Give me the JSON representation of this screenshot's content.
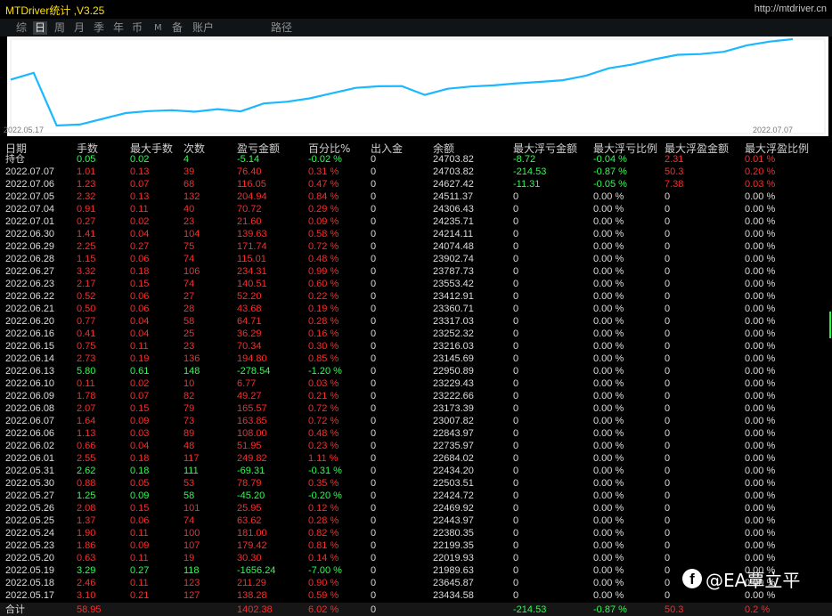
{
  "app_title": "MTDriver统计 ,V3.25",
  "site_link": "http://mtdriver.cn",
  "menu": [
    "综",
    "日",
    "周",
    "月",
    "季",
    "年",
    "币",
    "M",
    "备",
    "账户",
    "路径"
  ],
  "menu_active": "日",
  "chart": {
    "start_label": "2022.05.17",
    "end_label": "2022.07.07",
    "line_color": "#1ab8ff"
  },
  "chart_data": {
    "type": "line",
    "x_start": "2022.05.17",
    "x_end": "2022.07.07",
    "values": [
      23434.58,
      23645.87,
      21989.63,
      22019.93,
      22199.35,
      22380.35,
      22443.97,
      22469.92,
      22424.72,
      22503.51,
      22434.2,
      22684.02,
      22735.97,
      22843.97,
      23007.82,
      23173.39,
      23222.66,
      23229.43,
      22950.89,
      23145.69,
      23216.03,
      23252.32,
      23317.03,
      23360.71,
      23412.91,
      23553.42,
      23787.73,
      23902.74,
      24074.48,
      24214.11,
      24235.71,
      24306.43,
      24511.37,
      24627.42,
      24703.82
    ]
  },
  "headers": [
    "日期",
    "手数",
    "最大手数",
    "次数",
    "盈亏金额",
    "百分比%",
    "出入金",
    "余额",
    "最大浮亏金额",
    "最大浮亏比例",
    "最大浮盈金额",
    "最大浮盈比例"
  ],
  "position_row": {
    "label": "持仓",
    "lots": "0.05",
    "max_lots": "0.02",
    "count": "4",
    "pnl": "-5.14",
    "pct": "-0.02 %",
    "cash": "0",
    "balance": "24703.82",
    "max_loss": "-8.72",
    "max_loss_pct": "-0.04 %",
    "max_gain": "2.31",
    "max_gain_pct": "0.01 %"
  },
  "rows": [
    {
      "date": "2022.07.07",
      "lots": "1.01",
      "max_lots": "0.13",
      "count": "39",
      "pnl": "76.40",
      "pct": "0.31 %",
      "cash": "0",
      "balance": "24703.82",
      "max_loss": "-214.53",
      "max_loss_pct": "-0.87 %",
      "max_gain": "50.3",
      "max_gain_pct": "0.20 %"
    },
    {
      "date": "2022.07.06",
      "lots": "1.23",
      "max_lots": "0.07",
      "count": "68",
      "pnl": "116.05",
      "pct": "0.47 %",
      "cash": "0",
      "balance": "24627.42",
      "max_loss": "-11.31",
      "max_loss_pct": "-0.05 %",
      "max_gain": "7.38",
      "max_gain_pct": "0.03 %"
    },
    {
      "date": "2022.07.05",
      "lots": "2.32",
      "max_lots": "0.13",
      "count": "132",
      "pnl": "204.94",
      "pct": "0.84 %",
      "cash": "0",
      "balance": "24511.37",
      "max_loss": "0",
      "max_loss_pct": "0.00 %",
      "max_gain": "0",
      "max_gain_pct": "0.00 %"
    },
    {
      "date": "2022.07.04",
      "lots": "0.91",
      "max_lots": "0.11",
      "count": "40",
      "pnl": "70.72",
      "pct": "0.29 %",
      "cash": "0",
      "balance": "24306.43",
      "max_loss": "0",
      "max_loss_pct": "0.00 %",
      "max_gain": "0",
      "max_gain_pct": "0.00 %"
    },
    {
      "date": "2022.07.01",
      "lots": "0.27",
      "max_lots": "0.02",
      "count": "23",
      "pnl": "21.60",
      "pct": "0.09 %",
      "cash": "0",
      "balance": "24235.71",
      "max_loss": "0",
      "max_loss_pct": "0.00 %",
      "max_gain": "0",
      "max_gain_pct": "0.00 %"
    },
    {
      "date": "2022.06.30",
      "lots": "1.41",
      "max_lots": "0.04",
      "count": "104",
      "pnl": "139.63",
      "pct": "0.58 %",
      "cash": "0",
      "balance": "24214.11",
      "max_loss": "0",
      "max_loss_pct": "0.00 %",
      "max_gain": "0",
      "max_gain_pct": "0.00 %"
    },
    {
      "date": "2022.06.29",
      "lots": "2.25",
      "max_lots": "0.27",
      "count": "75",
      "pnl": "171.74",
      "pct": "0.72 %",
      "cash": "0",
      "balance": "24074.48",
      "max_loss": "0",
      "max_loss_pct": "0.00 %",
      "max_gain": "0",
      "max_gain_pct": "0.00 %"
    },
    {
      "date": "2022.06.28",
      "lots": "1.15",
      "max_lots": "0.06",
      "count": "74",
      "pnl": "115.01",
      "pct": "0.48 %",
      "cash": "0",
      "balance": "23902.74",
      "max_loss": "0",
      "max_loss_pct": "0.00 %",
      "max_gain": "0",
      "max_gain_pct": "0.00 %"
    },
    {
      "date": "2022.06.27",
      "lots": "3.32",
      "max_lots": "0.18",
      "count": "106",
      "pnl": "234.31",
      "pct": "0.99 %",
      "cash": "0",
      "balance": "23787.73",
      "max_loss": "0",
      "max_loss_pct": "0.00 %",
      "max_gain": "0",
      "max_gain_pct": "0.00 %"
    },
    {
      "date": "2022.06.23",
      "lots": "2.17",
      "max_lots": "0.15",
      "count": "74",
      "pnl": "140.51",
      "pct": "0.60 %",
      "cash": "0",
      "balance": "23553.42",
      "max_loss": "0",
      "max_loss_pct": "0.00 %",
      "max_gain": "0",
      "max_gain_pct": "0.00 %"
    },
    {
      "date": "2022.06.22",
      "lots": "0.52",
      "max_lots": "0.06",
      "count": "27",
      "pnl": "52.20",
      "pct": "0.22 %",
      "cash": "0",
      "balance": "23412.91",
      "max_loss": "0",
      "max_loss_pct": "0.00 %",
      "max_gain": "0",
      "max_gain_pct": "0.00 %"
    },
    {
      "date": "2022.06.21",
      "lots": "0.50",
      "max_lots": "0.06",
      "count": "28",
      "pnl": "43.68",
      "pct": "0.19 %",
      "cash": "0",
      "balance": "23360.71",
      "max_loss": "0",
      "max_loss_pct": "0.00 %",
      "max_gain": "0",
      "max_gain_pct": "0.00 %"
    },
    {
      "date": "2022.06.20",
      "lots": "0.77",
      "max_lots": "0.04",
      "count": "58",
      "pnl": "64.71",
      "pct": "0.28 %",
      "cash": "0",
      "balance": "23317.03",
      "max_loss": "0",
      "max_loss_pct": "0.00 %",
      "max_gain": "0",
      "max_gain_pct": "0.00 %"
    },
    {
      "date": "2022.06.16",
      "lots": "0.41",
      "max_lots": "0.04",
      "count": "25",
      "pnl": "36.29",
      "pct": "0.16 %",
      "cash": "0",
      "balance": "23252.32",
      "max_loss": "0",
      "max_loss_pct": "0.00 %",
      "max_gain": "0",
      "max_gain_pct": "0.00 %"
    },
    {
      "date": "2022.06.15",
      "lots": "0.75",
      "max_lots": "0.11",
      "count": "23",
      "pnl": "70.34",
      "pct": "0.30 %",
      "cash": "0",
      "balance": "23216.03",
      "max_loss": "0",
      "max_loss_pct": "0.00 %",
      "max_gain": "0",
      "max_gain_pct": "0.00 %"
    },
    {
      "date": "2022.06.14",
      "lots": "2.73",
      "max_lots": "0.19",
      "count": "136",
      "pnl": "194.80",
      "pct": "0.85 %",
      "cash": "0",
      "balance": "23145.69",
      "max_loss": "0",
      "max_loss_pct": "0.00 %",
      "max_gain": "0",
      "max_gain_pct": "0.00 %"
    },
    {
      "date": "2022.06.13",
      "lots": "5.80",
      "max_lots": "0.61",
      "count": "148",
      "pnl": "-278.54",
      "pct": "-1.20 %",
      "cash": "0",
      "balance": "22950.89",
      "max_loss": "0",
      "max_loss_pct": "0.00 %",
      "max_gain": "0",
      "max_gain_pct": "0.00 %"
    },
    {
      "date": "2022.06.10",
      "lots": "0.11",
      "max_lots": "0.02",
      "count": "10",
      "pnl": "6.77",
      "pct": "0.03 %",
      "cash": "0",
      "balance": "23229.43",
      "max_loss": "0",
      "max_loss_pct": "0.00 %",
      "max_gain": "0",
      "max_gain_pct": "0.00 %"
    },
    {
      "date": "2022.06.09",
      "lots": "1.78",
      "max_lots": "0.07",
      "count": "82",
      "pnl": "49.27",
      "pct": "0.21 %",
      "cash": "0",
      "balance": "23222.66",
      "max_loss": "0",
      "max_loss_pct": "0.00 %",
      "max_gain": "0",
      "max_gain_pct": "0.00 %"
    },
    {
      "date": "2022.06.08",
      "lots": "2.07",
      "max_lots": "0.15",
      "count": "79",
      "pnl": "165.57",
      "pct": "0.72 %",
      "cash": "0",
      "balance": "23173.39",
      "max_loss": "0",
      "max_loss_pct": "0.00 %",
      "max_gain": "0",
      "max_gain_pct": "0.00 %"
    },
    {
      "date": "2022.06.07",
      "lots": "1.64",
      "max_lots": "0.09",
      "count": "73",
      "pnl": "163.85",
      "pct": "0.72 %",
      "cash": "0",
      "balance": "23007.82",
      "max_loss": "0",
      "max_loss_pct": "0.00 %",
      "max_gain": "0",
      "max_gain_pct": "0.00 %"
    },
    {
      "date": "2022.06.06",
      "lots": "1.13",
      "max_lots": "0.03",
      "count": "89",
      "pnl": "108.00",
      "pct": "0.48 %",
      "cash": "0",
      "balance": "22843.97",
      "max_loss": "0",
      "max_loss_pct": "0.00 %",
      "max_gain": "0",
      "max_gain_pct": "0.00 %"
    },
    {
      "date": "2022.06.02",
      "lots": "0.66",
      "max_lots": "0.04",
      "count": "48",
      "pnl": "51.95",
      "pct": "0.23 %",
      "cash": "0",
      "balance": "22735.97",
      "max_loss": "0",
      "max_loss_pct": "0.00 %",
      "max_gain": "0",
      "max_gain_pct": "0.00 %"
    },
    {
      "date": "2022.06.01",
      "lots": "2.55",
      "max_lots": "0.18",
      "count": "117",
      "pnl": "249.82",
      "pct": "1.11 %",
      "cash": "0",
      "balance": "22684.02",
      "max_loss": "0",
      "max_loss_pct": "0.00 %",
      "max_gain": "0",
      "max_gain_pct": "0.00 %"
    },
    {
      "date": "2022.05.31",
      "lots": "2.62",
      "max_lots": "0.18",
      "count": "111",
      "pnl": "-69.31",
      "pct": "-0.31 %",
      "cash": "0",
      "balance": "22434.20",
      "max_loss": "0",
      "max_loss_pct": "0.00 %",
      "max_gain": "0",
      "max_gain_pct": "0.00 %"
    },
    {
      "date": "2022.05.30",
      "lots": "0.88",
      "max_lots": "0.05",
      "count": "53",
      "pnl": "78.79",
      "pct": "0.35 %",
      "cash": "0",
      "balance": "22503.51",
      "max_loss": "0",
      "max_loss_pct": "0.00 %",
      "max_gain": "0",
      "max_gain_pct": "0.00 %"
    },
    {
      "date": "2022.05.27",
      "lots": "1.25",
      "max_lots": "0.09",
      "count": "58",
      "pnl": "-45.20",
      "pct": "-0.20 %",
      "cash": "0",
      "balance": "22424.72",
      "max_loss": "0",
      "max_loss_pct": "0.00 %",
      "max_gain": "0",
      "max_gain_pct": "0.00 %"
    },
    {
      "date": "2022.05.26",
      "lots": "2.08",
      "max_lots": "0.15",
      "count": "101",
      "pnl": "25.95",
      "pct": "0.12 %",
      "cash": "0",
      "balance": "22469.92",
      "max_loss": "0",
      "max_loss_pct": "0.00 %",
      "max_gain": "0",
      "max_gain_pct": "0.00 %"
    },
    {
      "date": "2022.05.25",
      "lots": "1.37",
      "max_lots": "0.06",
      "count": "74",
      "pnl": "63.62",
      "pct": "0.28 %",
      "cash": "0",
      "balance": "22443.97",
      "max_loss": "0",
      "max_loss_pct": "0.00 %",
      "max_gain": "0",
      "max_gain_pct": "0.00 %"
    },
    {
      "date": "2022.05.24",
      "lots": "1.90",
      "max_lots": "0.11",
      "count": "100",
      "pnl": "181.00",
      "pct": "0.82 %",
      "cash": "0",
      "balance": "22380.35",
      "max_loss": "0",
      "max_loss_pct": "0.00 %",
      "max_gain": "0",
      "max_gain_pct": "0.00 %"
    },
    {
      "date": "2022.05.23",
      "lots": "1.86",
      "max_lots": "0.09",
      "count": "107",
      "pnl": "179.42",
      "pct": "0.81 %",
      "cash": "0",
      "balance": "22199.35",
      "max_loss": "0",
      "max_loss_pct": "0.00 %",
      "max_gain": "0",
      "max_gain_pct": "0.00 %"
    },
    {
      "date": "2022.05.20",
      "lots": "0.63",
      "max_lots": "0.11",
      "count": "19",
      "pnl": "30.30",
      "pct": "0.14 %",
      "cash": "0",
      "balance": "22019.93",
      "max_loss": "0",
      "max_loss_pct": "0.00 %",
      "max_gain": "0",
      "max_gain_pct": "0.00 %"
    },
    {
      "date": "2022.05.19",
      "lots": "3.29",
      "max_lots": "0.27",
      "count": "118",
      "pnl": "-1656.24",
      "pct": "-7.00 %",
      "cash": "0",
      "balance": "21989.63",
      "max_loss": "0",
      "max_loss_pct": "0.00 %",
      "max_gain": "0",
      "max_gain_pct": "0.00 %"
    },
    {
      "date": "2022.05.18",
      "lots": "2.46",
      "max_lots": "0.11",
      "count": "123",
      "pnl": "211.29",
      "pct": "0.90 %",
      "cash": "0",
      "balance": "23645.87",
      "max_loss": "0",
      "max_loss_pct": "0.00 %",
      "max_gain": "0",
      "max_gain_pct": "0.00 %"
    },
    {
      "date": "2022.05.17",
      "lots": "3.10",
      "max_lots": "0.21",
      "count": "127",
      "pnl": "138.28",
      "pct": "0.59 %",
      "cash": "0",
      "balance": "23434.58",
      "max_loss": "0",
      "max_loss_pct": "0.00 %",
      "max_gain": "0",
      "max_gain_pct": "0.00 %"
    }
  ],
  "total_row": {
    "label": "合计",
    "lots": "58.95",
    "pnl": "1402.38",
    "pct": "6.02 %",
    "cash": "0",
    "max_loss": "-214.53",
    "max_loss_pct": "-0.87 %",
    "max_gain": "50.3",
    "max_gain_pct": "0.2 %"
  },
  "watermark": {
    "icon": "f",
    "text": "@EA覃立平"
  },
  "colors": {
    "positive": "#ff2a2a",
    "negative": "#2aff4e",
    "neutral": "#dcdcdc",
    "header": "#cfcfcf",
    "title": "#ffe000"
  }
}
